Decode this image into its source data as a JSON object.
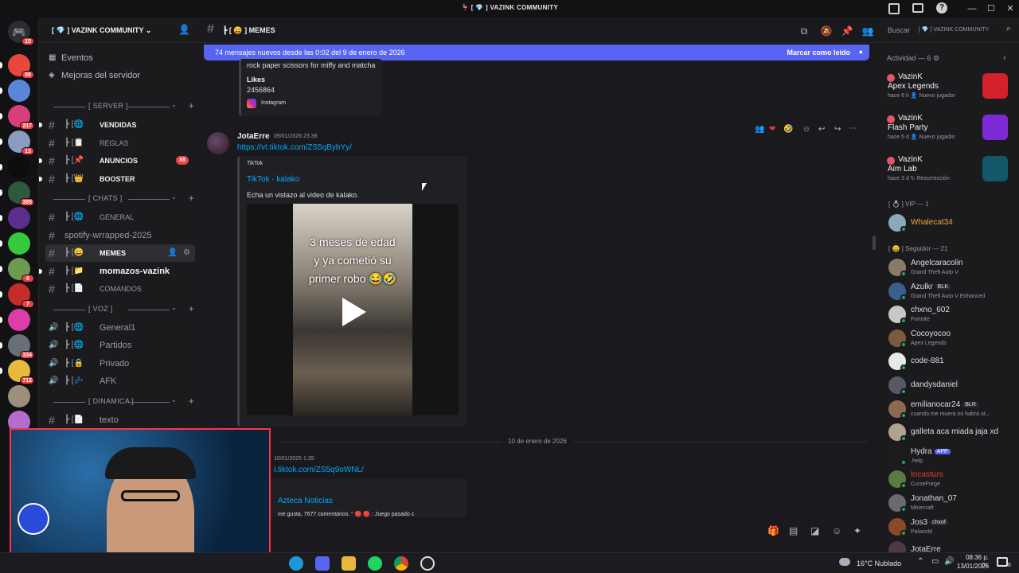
{
  "window": {
    "title": "VAZINK COMMUNITY",
    "controls": [
      "—",
      "☐",
      "✕"
    ]
  },
  "rail": {
    "servers": [
      {
        "color": "#e8473c",
        "badge": "88"
      },
      {
        "color": "#5a86d8",
        "badge": ""
      },
      {
        "color": "#d63f7a",
        "badge": "217"
      },
      {
        "color": "#8b9bc2",
        "badge": "13"
      },
      {
        "color": "#0d0d0d",
        "badge": ""
      },
      {
        "color": "#2d5a3c",
        "badge": "385"
      },
      {
        "color": "#5b2d8c",
        "badge": ""
      },
      {
        "color": "#35c93d",
        "badge": ""
      },
      {
        "color": "#6c9a4f",
        "badge": "6"
      },
      {
        "color": "#c42b2b",
        "badge": "7"
      },
      {
        "color": "#db3ea7",
        "badge": ""
      },
      {
        "color": "#6a6f77",
        "badge": "334"
      },
      {
        "color": "#e8b93b",
        "badge": "712"
      },
      {
        "color": "#9c8f7c",
        "badge": ""
      },
      {
        "color": "#b46ccf",
        "badge": ""
      }
    ],
    "home_badge": "15"
  },
  "sidebar": {
    "server_name": "VAZINK COMMUNITY",
    "events": "Eventos",
    "boosts": "Mejoras del servidor",
    "categories": [
      {
        "label": "SERVER",
        "channels": [
          {
            "glyph": "[🌐",
            "name": "VENDIDAS",
            "bold": true
          },
          {
            "glyph": "[📋",
            "name": "REGLAS"
          },
          {
            "glyph": "[📌",
            "name": "ANUNCIOS",
            "bold": true,
            "badge": "88"
          },
          {
            "glyph": "[👑",
            "name": "BOOSTER",
            "bold": true
          }
        ]
      },
      {
        "label": "CHATS",
        "channels": [
          {
            "glyph": "[🌐",
            "name": "GENERAL"
          },
          {
            "glyph": "",
            "name": "spotify-wrrapped-2025"
          },
          {
            "glyph": "[😄",
            "name": "MEMES",
            "selected": true
          },
          {
            "glyph": "[📁",
            "name": "momazos-vazink",
            "bold": true
          },
          {
            "glyph": "[📄",
            "name": "COMANDOS"
          }
        ]
      },
      {
        "label": "VOZ",
        "channels": [
          {
            "glyph": "[🌐",
            "name": "General1"
          },
          {
            "glyph": "[🌐",
            "name": "Partidos"
          },
          {
            "glyph": "[🔒",
            "name": "Privado"
          },
          {
            "glyph": "[💤",
            "name": "AFK"
          }
        ]
      },
      {
        "label": "DINAMICA",
        "channels": [
          {
            "glyph": "[📄",
            "name": "texto"
          }
        ]
      }
    ]
  },
  "header": {
    "channel": "MEMES",
    "search_placeholder": "Buscar",
    "search_scope": "VAZINK COMMUNITY"
  },
  "banner": {
    "text": "74 mensajes nuevos desde las 0:02 del 9 de enero de 2026",
    "action": "Marcar como leído"
  },
  "messages": {
    "prev_embed": {
      "text": "rock paper scissors for miffy and matcha",
      "likes_label": "Likes",
      "likes_value": "2456864",
      "source": "Instagram"
    },
    "msg1": {
      "author": "JotaErre",
      "time": "09/01/2026 23:38",
      "link": "https://vt.tiktok.com/ZS5qBybYy/",
      "embed_provider": "TikTok",
      "embed_title": "TikTok · kalako",
      "embed_desc": "Echa un vistazo al video de kalako.",
      "video_caption_1": "3 meses de edad",
      "video_caption_2": "y ya cometió su",
      "video_caption_3": "primer robo 😂🤣"
    },
    "date_divider": "10 de enero de 2026",
    "msg2": {
      "time": "10/01/2026 1:35",
      "link": "i.tiktok.com/ZS5q9oWNL/",
      "embed_title": "Azteca Noticias",
      "embed_desc": "me gusta, 7677 comentarios. \" 🔴 🔴 : Juego pasado c"
    }
  },
  "members": {
    "activity_label": "Actividad — 6",
    "activities": [
      {
        "user": "VazinK",
        "game": "Apex Legends",
        "sub": "hace 6 h  👤 Nuevo jugador",
        "color": "#d4202b"
      },
      {
        "user": "VazinK",
        "game": "Flash Party",
        "sub": "hace 5 d  👤 Nuevo jugador",
        "color": "#7d2ad6"
      },
      {
        "user": "VazinK",
        "game": "Aim Lab",
        "sub": "hace 3 d  ↻ Resurrección",
        "color": "#13576a"
      }
    ],
    "vip_label": "VIP — 1",
    "vip": [
      {
        "name": "Whalecat34",
        "color": "#f0a33a"
      }
    ],
    "follower_label": "Seguidor — 21",
    "followers": [
      {
        "name": "Angelcaracolin",
        "game": "Grand Theft Auto V",
        "av": "#8a7a6a"
      },
      {
        "name": "Azulkr",
        "tag": "BLK",
        "game": "Grand Theft Auto V Enhanced",
        "av": "#3c5e8c"
      },
      {
        "name": "chxno_602",
        "game": "Fortnite",
        "av": "#c8c8c8"
      },
      {
        "name": "Cocoyocoo",
        "game": "Apex Legends",
        "av": "#7c5a3c"
      },
      {
        "name": "code-881",
        "game": "",
        "av": "#e8e8e8"
      },
      {
        "name": "dandysdaniel",
        "game": "",
        "av": "#555a66"
      },
      {
        "name": "emilianocar24",
        "tag": "BLR",
        "game": "cuando me muera no habrá ot...",
        "av": "#8f6a52"
      },
      {
        "name": "galleta aca miada jaja xd",
        "game": "",
        "av": "#b0a490"
      },
      {
        "name": "Hydra",
        "tag": "APP",
        "game": ".help",
        "av": "#1c1c1c"
      },
      {
        "name": "Incasturs",
        "game": "CurseForge",
        "av": "#5a7a44",
        "red": true
      },
      {
        "name": "Jonathan_07",
        "game": "Minecraft",
        "av": "#6a6a72"
      },
      {
        "name": "Jos3",
        "tag": "chxof",
        "game": "Palworld",
        "av": "#8a4a2a"
      },
      {
        "name": "JotaErre",
        "game": "",
        "av": "#4a3a4a"
      }
    ]
  },
  "taskbar": {
    "weather": "16°C  Nublado",
    "time": "08:36 p. m.",
    "date": "13/01/2026",
    "notif": "6"
  }
}
